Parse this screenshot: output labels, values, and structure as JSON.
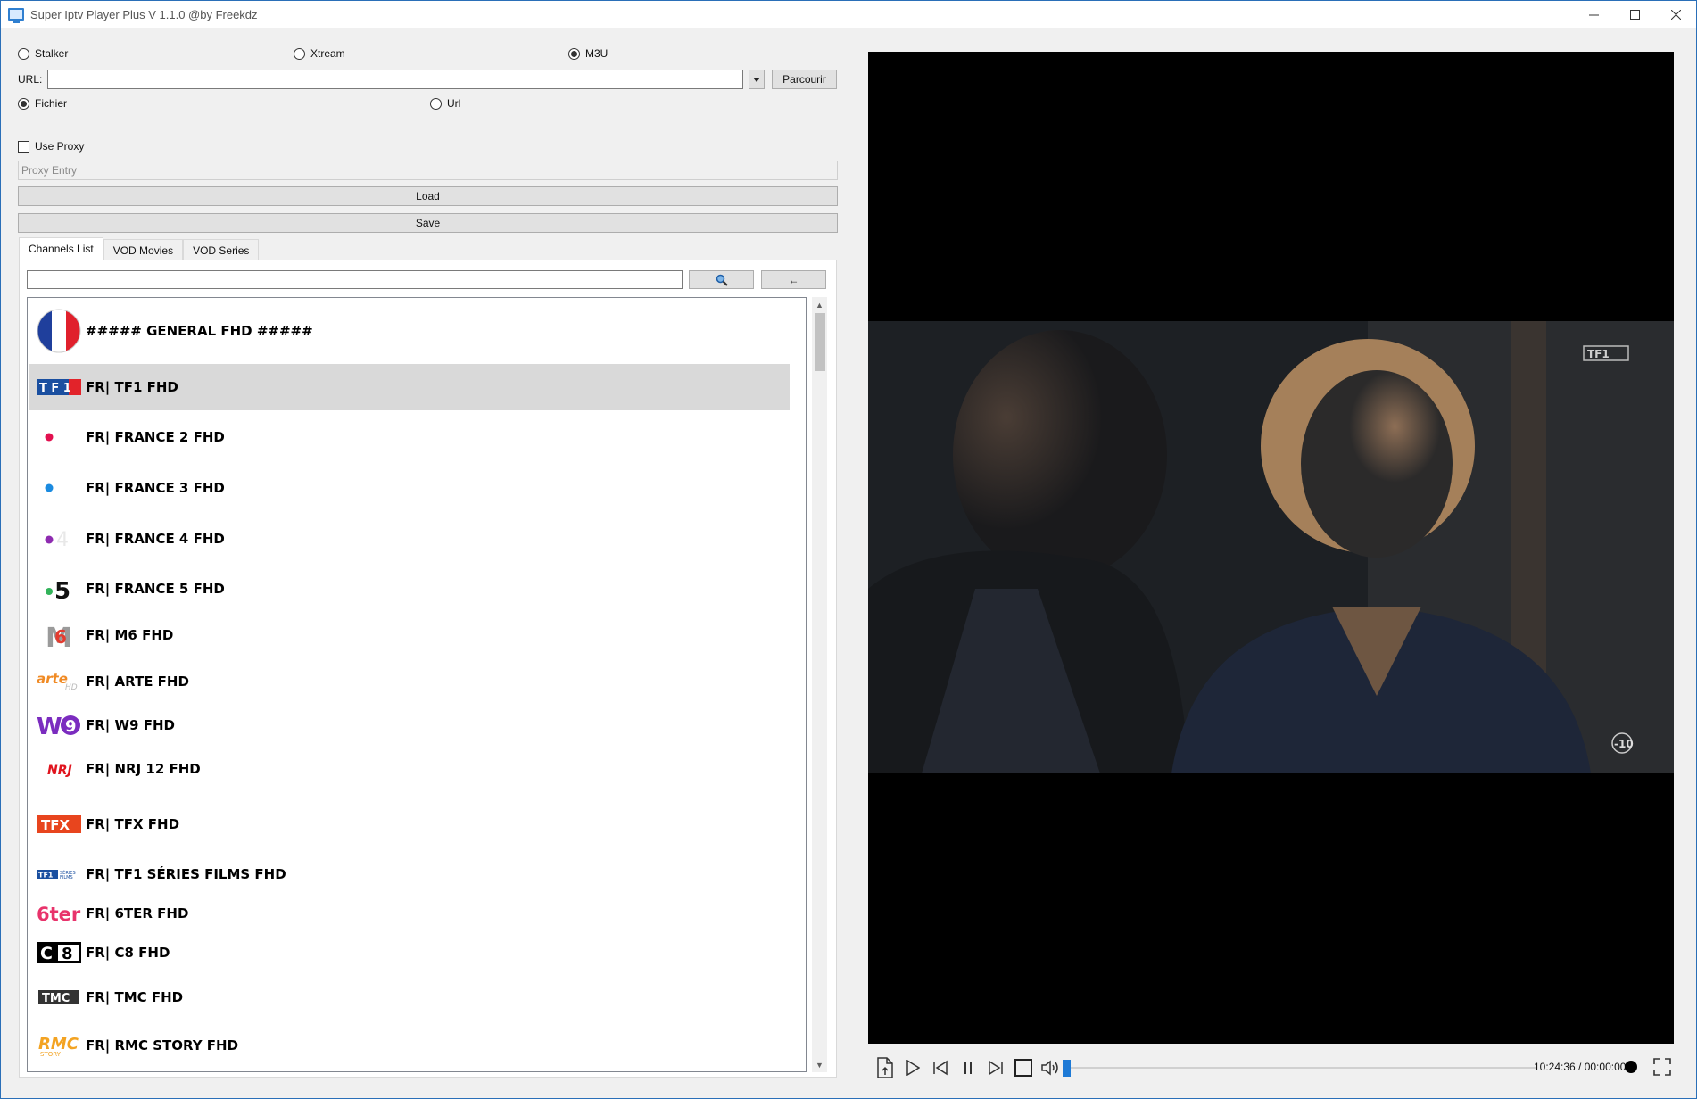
{
  "window": {
    "title": "Super Iptv Player Plus V 1.1.0 @by Freekdz"
  },
  "source_type": {
    "options": [
      "Stalker",
      "Xtream",
      "M3U"
    ],
    "selected": "M3U"
  },
  "url": {
    "label": "URL:",
    "value": "",
    "browse_label": "Parcourir"
  },
  "location_type": {
    "options": [
      "Fichier",
      "Url"
    ],
    "selected": "Fichier"
  },
  "proxy": {
    "checkbox_label": "Use Proxy",
    "checked": false,
    "placeholder": "Proxy Entry"
  },
  "actions": {
    "load_label": "Load",
    "save_label": "Save"
  },
  "tabs": [
    {
      "label": "Channels List",
      "active": true
    },
    {
      "label": "VOD Movies",
      "active": false
    },
    {
      "label": "VOD Series",
      "active": false
    }
  ],
  "search": {
    "value": "",
    "back_label": "←"
  },
  "channels": [
    {
      "name": "##### GENERAL FHD #####",
      "logo": "france-flag",
      "selected": false
    },
    {
      "name": "FR| TF1 FHD",
      "logo": "TF1",
      "selected": true
    },
    {
      "name": "FR| FRANCE 2 FHD",
      "logo": "france-2",
      "selected": false
    },
    {
      "name": "FR| FRANCE 3 FHD",
      "logo": "france-3",
      "selected": false
    },
    {
      "name": "FR| FRANCE 4 FHD",
      "logo": "france-4",
      "selected": false
    },
    {
      "name": "FR| FRANCE 5 FHD",
      "logo": "france-5",
      "selected": false
    },
    {
      "name": "FR| M6 FHD",
      "logo": "M6",
      "selected": false
    },
    {
      "name": "FR| ARTE FHD",
      "logo": "arte",
      "selected": false
    },
    {
      "name": "FR| W9 FHD",
      "logo": "W9",
      "selected": false
    },
    {
      "name": "FR| NRJ 12 FHD",
      "logo": "NRJ",
      "selected": false
    },
    {
      "name": "FR| TFX FHD",
      "logo": "TFX",
      "selected": false
    },
    {
      "name": "FR| TF1 SÉRIES FILMS FHD",
      "logo": "TF1-series-films",
      "selected": false
    },
    {
      "name": "FR| 6TER FHD",
      "logo": "6ter",
      "selected": false
    },
    {
      "name": "FR| C8 FHD",
      "logo": "C8",
      "selected": false
    },
    {
      "name": "FR| TMC FHD",
      "logo": "TMC",
      "selected": false
    },
    {
      "name": "FR| RMC STORY FHD",
      "logo": "RMC",
      "selected": false
    }
  ],
  "player": {
    "time": "10:24:36 / 00:00:00",
    "progress": 0.0,
    "volume": 0.0,
    "watermark": "TF1",
    "rating_badge": "-10"
  },
  "colors": {
    "accent": "#1e7ad6",
    "selection": "#d9d9d9",
    "video_bg": "#000000"
  }
}
